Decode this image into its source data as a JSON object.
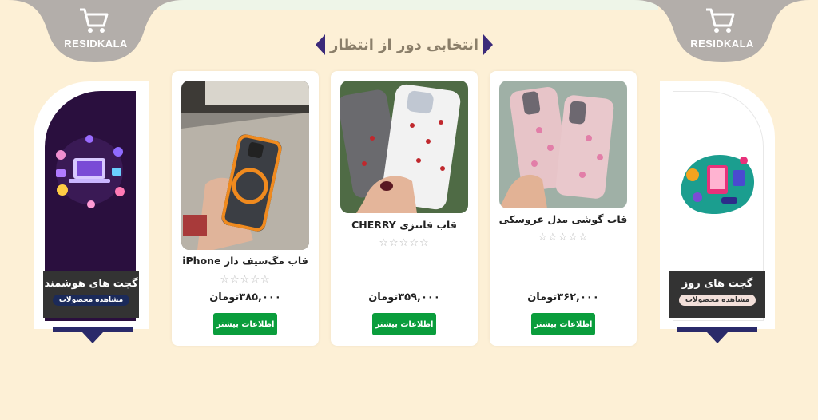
{
  "brand": {
    "name": "RESIDKALA"
  },
  "section": {
    "title": "انتخابی دور از انتظار"
  },
  "side_banners": {
    "left": {
      "title": "گجت های هوشمند",
      "link": "مشاهده محصولات",
      "icon": "smart-gadgets-illustration"
    },
    "right": {
      "title": "گجت های روز",
      "link": "مشاهده محصولات",
      "icon": "daily-gadgets-illustration"
    }
  },
  "products": [
    {
      "name": "قاب مگ‌سیف دار iPhone",
      "stars": "☆☆☆☆☆",
      "rating": 0,
      "price": "۳۸۵,۰۰۰تومان",
      "button": "اطلاعات بیشتر",
      "image": "magsafe-case-photo"
    },
    {
      "name": "قاب فانتزی CHERRY",
      "stars": "☆☆☆☆☆",
      "rating": 0,
      "price": "۳۵۹,۰۰۰تومان",
      "button": "اطلاعات بیشتر",
      "image": "cherry-case-photo"
    },
    {
      "name": "قاب گوشی مدل عروسکی",
      "stars": "☆☆☆☆☆",
      "rating": 0,
      "price": "۳۶۲,۰۰۰تومان",
      "button": "اطلاعات بیشتر",
      "image": "bow-case-photo"
    }
  ],
  "colors": {
    "background": "#fdf0d6",
    "accent_dark": "#3b2a7a",
    "button_green": "#0a9d3c",
    "corner_gray": "#b3aeaa"
  }
}
